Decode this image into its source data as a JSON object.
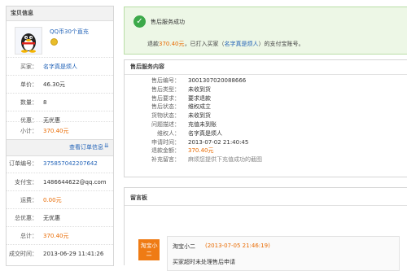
{
  "sidebar": {
    "title": "宝贝信息",
    "product_name": "QQ币30个直充",
    "rows": [
      {
        "k": "买家：",
        "v": "名字真是烦人"
      },
      {
        "k": "单价：",
        "v": "46.30元"
      },
      {
        "k": "数量：",
        "v": "8"
      },
      {
        "k": "优惠：",
        "v": "无优惠"
      },
      {
        "k": "小计：",
        "v": "370.40元"
      }
    ],
    "view_order": "查看订单信息",
    "order_rows": [
      {
        "k": "订单编号：",
        "v": "375857042207642"
      },
      {
        "k": "支付宝：",
        "v": "1486644622@qq.com"
      },
      {
        "k": "运费：",
        "v": "0.00元"
      },
      {
        "k": "总优惠：",
        "v": "无优惠"
      },
      {
        "k": "总计：",
        "v": "370.40元"
      },
      {
        "k": "成交时间：",
        "v": "2013-06-29 11:41:26"
      }
    ]
  },
  "success": {
    "title": "售后服务成功",
    "desc_prefix": "退款",
    "amount": "370.40元",
    "desc_mid": "，已打入买家（",
    "buyer": "名字真是烦人",
    "desc_suffix": "）的支付宝账号。"
  },
  "service": {
    "title": "售后服务内容",
    "rows": [
      {
        "k": "售后编号：",
        "v": "3001307020088666"
      },
      {
        "k": "售后类型：",
        "v": "未收到货"
      },
      {
        "k": "售后要求：",
        "v": "要求退款"
      },
      {
        "k": "售后状态：",
        "v": "维权成立"
      },
      {
        "k": "货物状态：",
        "v": "未收到货"
      },
      {
        "k": "问题描述：",
        "v": "充值未到账"
      },
      {
        "k": "维权人：",
        "v": "名字真是烦人"
      },
      {
        "k": "申请时间：",
        "v": "2013-07-02 21:40:45"
      },
      {
        "k": "退款金额：",
        "v": "370.40元"
      },
      {
        "k": "补充留言：",
        "v": "麻烦您提供下充值成功的截图"
      }
    ]
  },
  "board": {
    "title": "留言板",
    "avatar": "淘宝小二",
    "author": "淘宝小二",
    "time": "(2013-07-05 21:46:19)",
    "text": "买家超时未处理售后申请"
  },
  "colors": {
    "accent_blue": "#2464b8",
    "accent_orange": "#e96a00",
    "success_green": "#3ca94a"
  }
}
